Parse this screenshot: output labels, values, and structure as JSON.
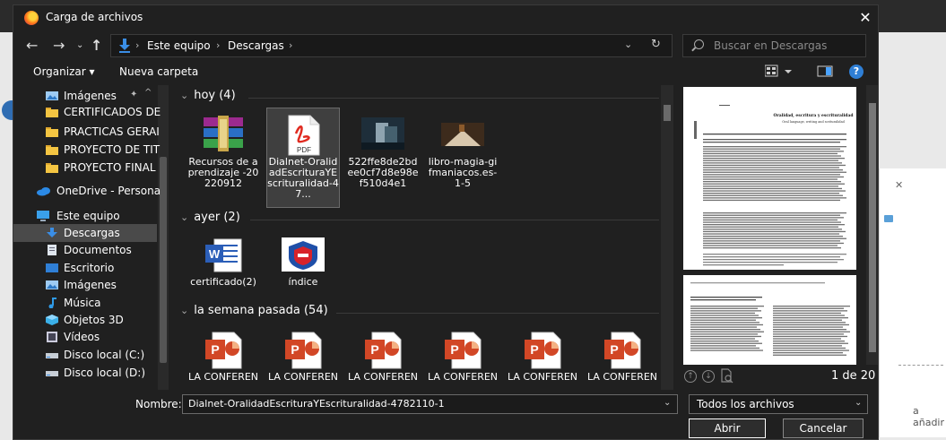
{
  "dialog": {
    "title": "Carga de archivos",
    "close_glyph": "✕"
  },
  "background": {
    "right_text": "a añadir"
  },
  "address": {
    "crumbs": [
      "Este equipo",
      "Descargas"
    ],
    "dropdown_glyph": "⌄",
    "refresh_glyph": "↻"
  },
  "search": {
    "placeholder": "Buscar en Descargas"
  },
  "toolbar": {
    "organize": "Organizar ▾",
    "new_folder": "Nueva carpeta",
    "help": "?"
  },
  "nav_pane": {
    "items": [
      {
        "label": "Imágenes",
        "icon": "images-icon",
        "pinned": true
      },
      {
        "label": "CERTIFICADOS DE",
        "icon": "folder-icon"
      },
      {
        "label": "PRACTICAS GERAI",
        "icon": "folder-icon"
      },
      {
        "label": "PROYECTO DE TIT",
        "icon": "folder-icon"
      },
      {
        "label": "PROYECTO FINAL",
        "icon": "folder-icon"
      },
      {
        "label": "OneDrive - Persona",
        "icon": "onedrive-icon"
      },
      {
        "label": "Este equipo",
        "icon": "computer-icon"
      },
      {
        "label": "Descargas",
        "icon": "download-icon",
        "selected": true
      },
      {
        "label": "Documentos",
        "icon": "documents-icon"
      },
      {
        "label": "Escritorio",
        "icon": "desktop-icon"
      },
      {
        "label": "Imágenes",
        "icon": "images-icon"
      },
      {
        "label": "Música",
        "icon": "music-icon"
      },
      {
        "label": "Objetos 3D",
        "icon": "objects3d-icon"
      },
      {
        "label": "Vídeos",
        "icon": "videos-icon"
      },
      {
        "label": "Disco local (C:)",
        "icon": "drive-icon"
      },
      {
        "label": "Disco local (D:)",
        "icon": "drive-icon"
      }
    ]
  },
  "groups": [
    {
      "title": "hoy (4)",
      "files": [
        {
          "label": "Recursos de aprendizaje -20220912",
          "icon": "winrar-icon"
        },
        {
          "label": "Dialnet-OralidadEscrituraYEscrituralidad-47...",
          "icon": "pdf-icon",
          "selected": true
        },
        {
          "label": "522ffe8de2bdee0cf7d8e98ef510d4e1",
          "icon": "image-thumb-icon"
        },
        {
          "label": "libro-magia-gifmaniacos.es-1-5",
          "icon": "gif-thumb-icon"
        }
      ]
    },
    {
      "title": "ayer (2)",
      "files": [
        {
          "label": "certificado(2)",
          "icon": "word-icon"
        },
        {
          "label": "índice",
          "icon": "shield-image-icon"
        }
      ]
    },
    {
      "title": "la semana pasada (54)",
      "files": [
        {
          "label": "LA CONFEREN",
          "icon": "powerpoint-icon"
        },
        {
          "label": "LA CONFEREN",
          "icon": "powerpoint-icon"
        },
        {
          "label": "LA CONFEREN",
          "icon": "powerpoint-icon"
        },
        {
          "label": "LA CONFEREN",
          "icon": "powerpoint-icon"
        },
        {
          "label": "LA CONFEREN",
          "icon": "powerpoint-icon"
        },
        {
          "label": "LA CONFEREN",
          "icon": "powerpoint-icon"
        }
      ]
    }
  ],
  "preview": {
    "doc_title": "Oralidad, escritura y escrituralidad",
    "doc_subtitle": "Oral language, writing and scrituralidad",
    "page_indicator": "1 de 20"
  },
  "bottom": {
    "filename_label": "Nombre:",
    "filename_value": "Dialnet-OralidadEscrituraYEscrituralidad-4782110-1",
    "filter_value": "Todos los archivos",
    "open_label": "Abrir",
    "cancel_label": "Cancelar"
  },
  "colors": {
    "dialog_bg": "#202020",
    "selection_bg": "#4a4a4a",
    "accent_blue": "#2f7fd6",
    "folder_yellow": "#f4c542",
    "pdf_red": "#e02b20",
    "ppt_orange": "#d24726",
    "word_blue": "#2b5eb8"
  }
}
